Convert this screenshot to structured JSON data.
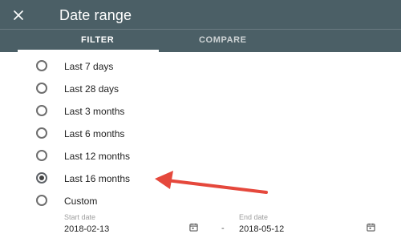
{
  "header": {
    "title": "Date range",
    "close_icon": "close-icon"
  },
  "tabs": [
    {
      "label": "FILTER",
      "active": true
    },
    {
      "label": "COMPARE",
      "active": false
    }
  ],
  "options": [
    {
      "label": "Last 7 days",
      "selected": false
    },
    {
      "label": "Last 28 days",
      "selected": false
    },
    {
      "label": "Last 3 months",
      "selected": false
    },
    {
      "label": "Last 6 months",
      "selected": false
    },
    {
      "label": "Last 12 months",
      "selected": false
    },
    {
      "label": "Last 16 months",
      "selected": true
    },
    {
      "label": "Custom",
      "selected": false
    }
  ],
  "custom": {
    "start_label": "Start date",
    "start_value": "2018-02-13",
    "end_label": "End date",
    "end_value": "2018-05-12",
    "separator": "-"
  },
  "colors": {
    "header_bg": "#4b5f66",
    "annotation_arrow": "#e5483c"
  }
}
